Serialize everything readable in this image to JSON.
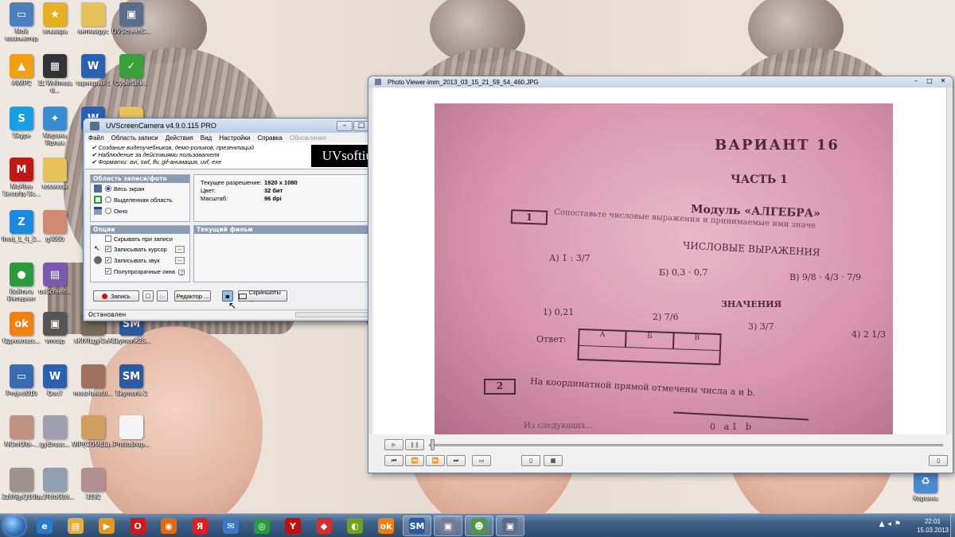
{
  "desktop": {
    "icons": [
      {
        "label": "Мой компьютер",
        "icon": "computer-icon",
        "color": "#4a7fc0",
        "glyph": "▭"
      },
      {
        "label": "эльвира",
        "icon": "star-icon",
        "color": "#e8b020",
        "glyph": "★"
      },
      {
        "label": "антивирус",
        "icon": "folder-icon",
        "color": "#e6c25a",
        "glyph": ""
      },
      {
        "label": "UVScreenC...",
        "icon": "uvscreencamera-icon",
        "color": "#5a6d8a",
        "glyph": "▣"
      },
      {
        "label": "AIMP2",
        "icon": "aimp-icon",
        "color": "#f0a010",
        "glyph": "▲"
      },
      {
        "label": "11 Wellness d...",
        "icon": "video-file-icon",
        "color": "#333333",
        "glyph": "▦"
      },
      {
        "label": "сценарий 1",
        "icon": "word-doc-icon",
        "color": "#2b5fb0",
        "glyph": "W"
      },
      {
        "label": "CyberLink...",
        "icon": "cyberlink-icon",
        "color": "#3aa03a",
        "glyph": "✓"
      },
      {
        "label": "Skype",
        "icon": "skype-icon",
        "color": "#1aa0e0",
        "glyph": "S"
      },
      {
        "label": "Мирана Ярлык",
        "icon": "butterfly-icon",
        "color": "#3a8ad0",
        "glyph": "✦"
      },
      {
        "label": "",
        "icon": "word-doc-icon",
        "color": "#2b5fb0",
        "glyph": "W"
      },
      {
        "label": "",
        "icon": "folder-icon",
        "color": "#e6c25a",
        "glyph": ""
      },
      {
        "label": "McAfee Security Sc...",
        "icon": "mcafee-icon",
        "color": "#c01818",
        "glyph": "M"
      },
      {
        "label": "комиксы",
        "icon": "folder-icon",
        "color": "#e6c25a",
        "glyph": ""
      },
      {
        "label": "thod_1_4_2...",
        "icon": "torrent-icon",
        "color": "#1a8ae0",
        "glyph": "Z"
      },
      {
        "label": "g4050",
        "icon": "image-file-icon",
        "color": "#d08a70",
        "glyph": ""
      },
      {
        "label": "Войти в Интернет",
        "icon": "internet-icon",
        "color": "#2a9a3a",
        "glyph": "●"
      },
      {
        "label": "uvScreen...",
        "icon": "winrar-icon",
        "color": "#7a5ab0",
        "glyph": "▤"
      },
      {
        "label": "Однокласс...",
        "icon": "odnoklassniki-icon",
        "color": "#f08010",
        "glyph": "ok"
      },
      {
        "label": "vmcap",
        "icon": "vmcap-icon",
        "color": "#555555",
        "glyph": "▣"
      },
      {
        "label": "sKfXfLgyCeA",
        "icon": "photo-file-icon",
        "color": "#7a6a5a",
        "glyph": ""
      },
      {
        "label": "Skymonk2S...",
        "icon": "skymonk-icon",
        "color": "#2a5aa0",
        "glyph": "SM"
      },
      {
        "label": "Project010",
        "icon": "project-icon",
        "color": "#3a6ab0",
        "glyph": "▭"
      },
      {
        "label": "Doc7",
        "icon": "word-doc-icon",
        "color": "#2b5fb0",
        "glyph": "W"
      },
      {
        "label": "most-beauti...",
        "icon": "photo-file-icon",
        "color": "#a07060",
        "glyph": ""
      },
      {
        "label": "Skymonk 2",
        "icon": "skymonk-icon",
        "color": "#2a5aa0",
        "glyph": "SM"
      },
      {
        "label": "NGmUIbi-...",
        "icon": "photo-file-icon",
        "color": "#c09080",
        "glyph": ""
      },
      {
        "label": "gyEnsac...",
        "icon": "photo-file-icon",
        "color": "#a0a0b0",
        "glyph": ""
      },
      {
        "label": "MiP(COMEL)...",
        "icon": "photo-file-icon",
        "color": "#d0a060",
        "glyph": ""
      },
      {
        "label": "Photoshop...",
        "icon": "file-icon",
        "color": "#f4f4f4",
        "glyph": ""
      },
      {
        "label": "2z8f9jpQ1U...",
        "icon": "photo-file-icon",
        "color": "#a09090",
        "glyph": ""
      },
      {
        "label": "bcJTcfb0Bd...",
        "icon": "photo-file-icon",
        "color": "#90a0b0",
        "glyph": ""
      },
      {
        "label": "3182",
        "icon": "photo-file-icon",
        "color": "#b09090",
        "glyph": ""
      },
      {
        "label": "Корзина",
        "icon": "recycle-bin-icon",
        "color": "#4a8ad0",
        "glyph": "♻"
      }
    ]
  },
  "uv": {
    "title": "UVScreenCamera v4.9.0.115 PRO",
    "menu": [
      "Файл",
      "Область записи",
      "Действия",
      "Вид",
      "Настройки",
      "Справка",
      "Обновления"
    ],
    "features": [
      "Создание видеоучебников, демо-роликов, презентаций",
      "Наблюдение за действиями пользователя",
      "Форматы: avi, swf, flv, gif-анимация, uvf, exe"
    ],
    "logo": "UVsoftium",
    "area_header": "Область записи/фото",
    "area_options": [
      "Весь экран",
      "Выделенная область",
      "Окно"
    ],
    "info": [
      {
        "k": "Текущее разрешение:",
        "v": "1920 x 1080"
      },
      {
        "k": "Цвет:",
        "v": "32 бит"
      },
      {
        "k": "Масштаб:",
        "v": "96 dpi"
      }
    ],
    "options_header": "Опции",
    "options": [
      {
        "label": "Скрывать при записи",
        "checked": false
      },
      {
        "label": "Записывать курсор",
        "checked": true
      },
      {
        "label": "Записывать звук",
        "checked": true
      },
      {
        "label": "Полупрозрачные окна",
        "checked": true
      }
    ],
    "help_mark": "[?]",
    "movie_header": "Текущий фильм",
    "record_label": "Запись",
    "editor_label": "Редактор ...",
    "screenshots_label": "Скриншоты ...",
    "status": "Остановлен"
  },
  "pv": {
    "title": "Photo Viewer-imm_2013_03_15_21_59_54_460.JPG",
    "photo": {
      "variant": "ВАРИАНТ 16",
      "part": "ЧАСТЬ 1",
      "module": "Модуль «АЛГЕБРА»",
      "task1_num": "1",
      "task1": "Сопоставьте числовые выражения и принимаемые ими значе",
      "numeric_expr": "ЧИСЛОВЫЕ ВЫРАЖЕНИЯ",
      "expr_a": "А) 1 : 3/7",
      "expr_b": "Б) 0,3 · 0,7",
      "expr_c": "В) 9/8 · 4/3 · 7/9",
      "values_title": "ЗНАЧЕНИЯ",
      "v1": "1) 0,21",
      "v2": "2) 7/6",
      "v3": "3) 3/7",
      "v4": "4) 2 1/3",
      "answer": "Ответ:",
      "answer_cols": [
        "А",
        "Б",
        "В"
      ],
      "task2_num": "2",
      "task2": "На координатной прямой отмечены числа a и b.",
      "axis_labels": "0   a 1   b",
      "bottom_text": "Из следующих..."
    }
  },
  "taskbar": {
    "time": "22:01",
    "date": "15.03.2013",
    "apps": [
      {
        "name": "ie",
        "icon": "internet-explorer-icon",
        "color": "#2a7ad0",
        "glyph": "e",
        "active": false
      },
      {
        "name": "explorer",
        "icon": "file-explorer-icon",
        "color": "#e0b040",
        "glyph": "▤",
        "active": false
      },
      {
        "name": "media",
        "icon": "media-player-icon",
        "color": "#e09a20",
        "glyph": "▶",
        "active": false
      },
      {
        "name": "opera",
        "icon": "opera-icon",
        "color": "#d01818",
        "glyph": "O",
        "active": false
      },
      {
        "name": "firefox",
        "icon": "firefox-icon",
        "color": "#e06a10",
        "glyph": "◉",
        "active": false
      },
      {
        "name": "yandex",
        "icon": "yandex-icon",
        "color": "#e02020",
        "glyph": "Я",
        "active": false
      },
      {
        "name": "mail",
        "icon": "mail-icon",
        "color": "#3a7ac0",
        "glyph": "✉",
        "active": false
      },
      {
        "name": "chrome",
        "icon": "chrome-icon",
        "color": "#2a9a40",
        "glyph": "◎",
        "active": false
      },
      {
        "name": "yabrowser",
        "icon": "yandex-browser-icon",
        "color": "#c01010",
        "glyph": "Y",
        "active": false
      },
      {
        "name": "fdm",
        "icon": "download-manager-icon",
        "color": "#d03030",
        "glyph": "◆",
        "active": false
      },
      {
        "name": "game",
        "icon": "game-icon",
        "color": "#70a020",
        "glyph": "◐",
        "active": false
      },
      {
        "name": "ok",
        "icon": "odnoklassniki-icon",
        "color": "#f08010",
        "glyph": "ok",
        "active": false
      },
      {
        "name": "skymonk",
        "icon": "skymonk-icon",
        "color": "#2a5aa0",
        "glyph": "SM",
        "active": true
      },
      {
        "name": "photo",
        "icon": "photo-viewer-icon",
        "color": "#7a7a9a",
        "glyph": "▣",
        "active": true
      },
      {
        "name": "user",
        "icon": "user-icon",
        "color": "#4a9a4a",
        "glyph": "☻",
        "active": true
      },
      {
        "name": "uvscreen",
        "icon": "uvscreencamera-icon",
        "color": "#5a6d8a",
        "glyph": "▣",
        "active": true
      }
    ]
  }
}
